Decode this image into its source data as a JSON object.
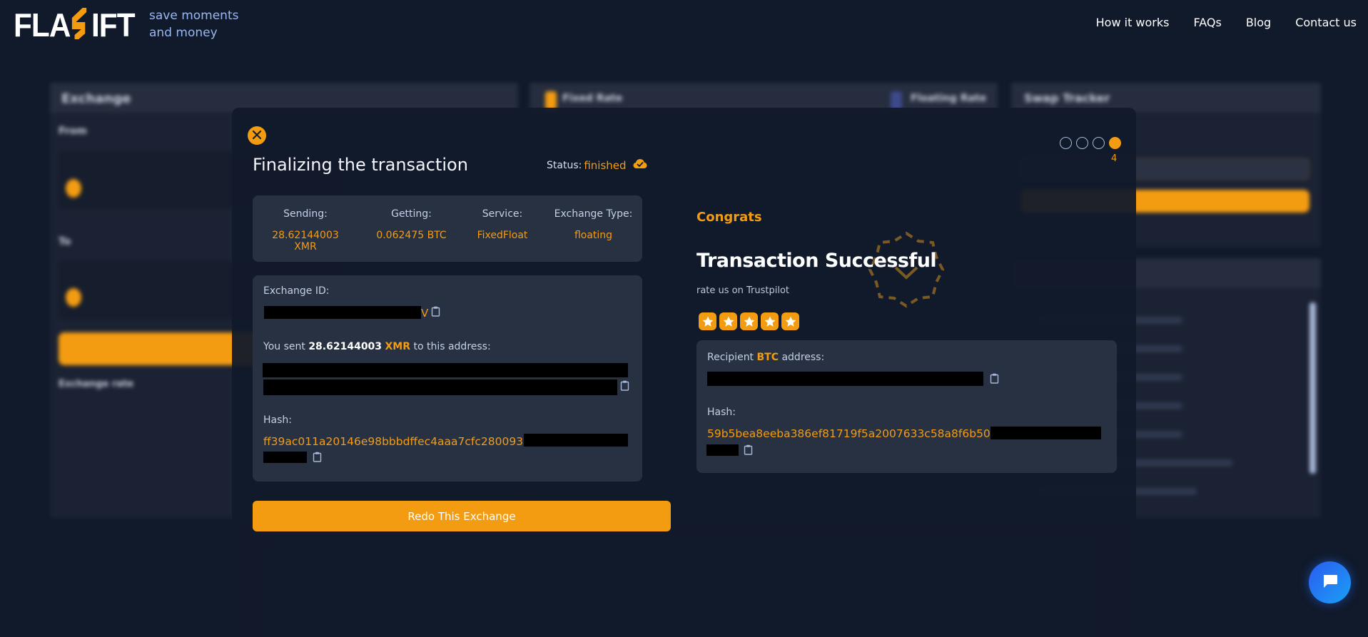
{
  "brand": {
    "logo_left": "FLA",
    "logo_mid": "S",
    "logo_right": "IFT",
    "tagline_line1": "save moments",
    "tagline_line2": "and money",
    "accent_color": "#f39c12"
  },
  "nav": {
    "items": [
      {
        "label": "How it works"
      },
      {
        "label": "FAQs"
      },
      {
        "label": "Blog"
      },
      {
        "label": "Contact us"
      }
    ]
  },
  "modal": {
    "close_icon": "close-icon",
    "title": "Finalizing the transaction",
    "status_label": "Status:",
    "status_value": "finished",
    "status_icon": "cloud-check-icon",
    "summary": {
      "sending_label": "Sending:",
      "sending_value": "28.62144003 XMR",
      "getting_label": "Getting:",
      "getting_value": "0.062475 BTC",
      "service_label": "Service:",
      "service_value": "FixedFloat",
      "type_label": "Exchange Type:",
      "type_value": "floating"
    },
    "details": {
      "exchange_id_label": "Exchange ID:",
      "exchange_id_visible_tail": "V",
      "sent_prefix": "You sent ",
      "sent_amount": "28.62144003",
      "sent_currency": "XMR",
      "sent_suffix": " to this address:",
      "hash_label": "Hash:",
      "hash_visible": "ff39ac011a20146e98bbbdffec4aaa7cfc280093"
    },
    "redo_button": "Redo This Exchange",
    "congrats": "Congrats",
    "success_title": "Transaction Successful",
    "rate_text": "rate us on Trustpilot",
    "rating": {
      "stars": 5,
      "max": 5
    },
    "recipient": {
      "label_prefix": "Recipient ",
      "label_currency": "BTC",
      "label_suffix": " address:",
      "hash_label": "Hash:",
      "hash_visible": "59b5bea8eeba386ef81719f5a2007633c58a8f6b50"
    },
    "steps": {
      "total": 4,
      "current": 4,
      "current_label": "4"
    }
  },
  "background": {
    "exchange_panel_title": "Exchange",
    "from_label": "From",
    "to_label": "To",
    "exchange_rate_label": "Exchange rate",
    "fixed_rate_label": "Fixed Rate",
    "floating_rate_label": "Floating Rate",
    "tracker_title": "Swap Tracker"
  },
  "chat": {
    "icon": "chat-icon"
  }
}
